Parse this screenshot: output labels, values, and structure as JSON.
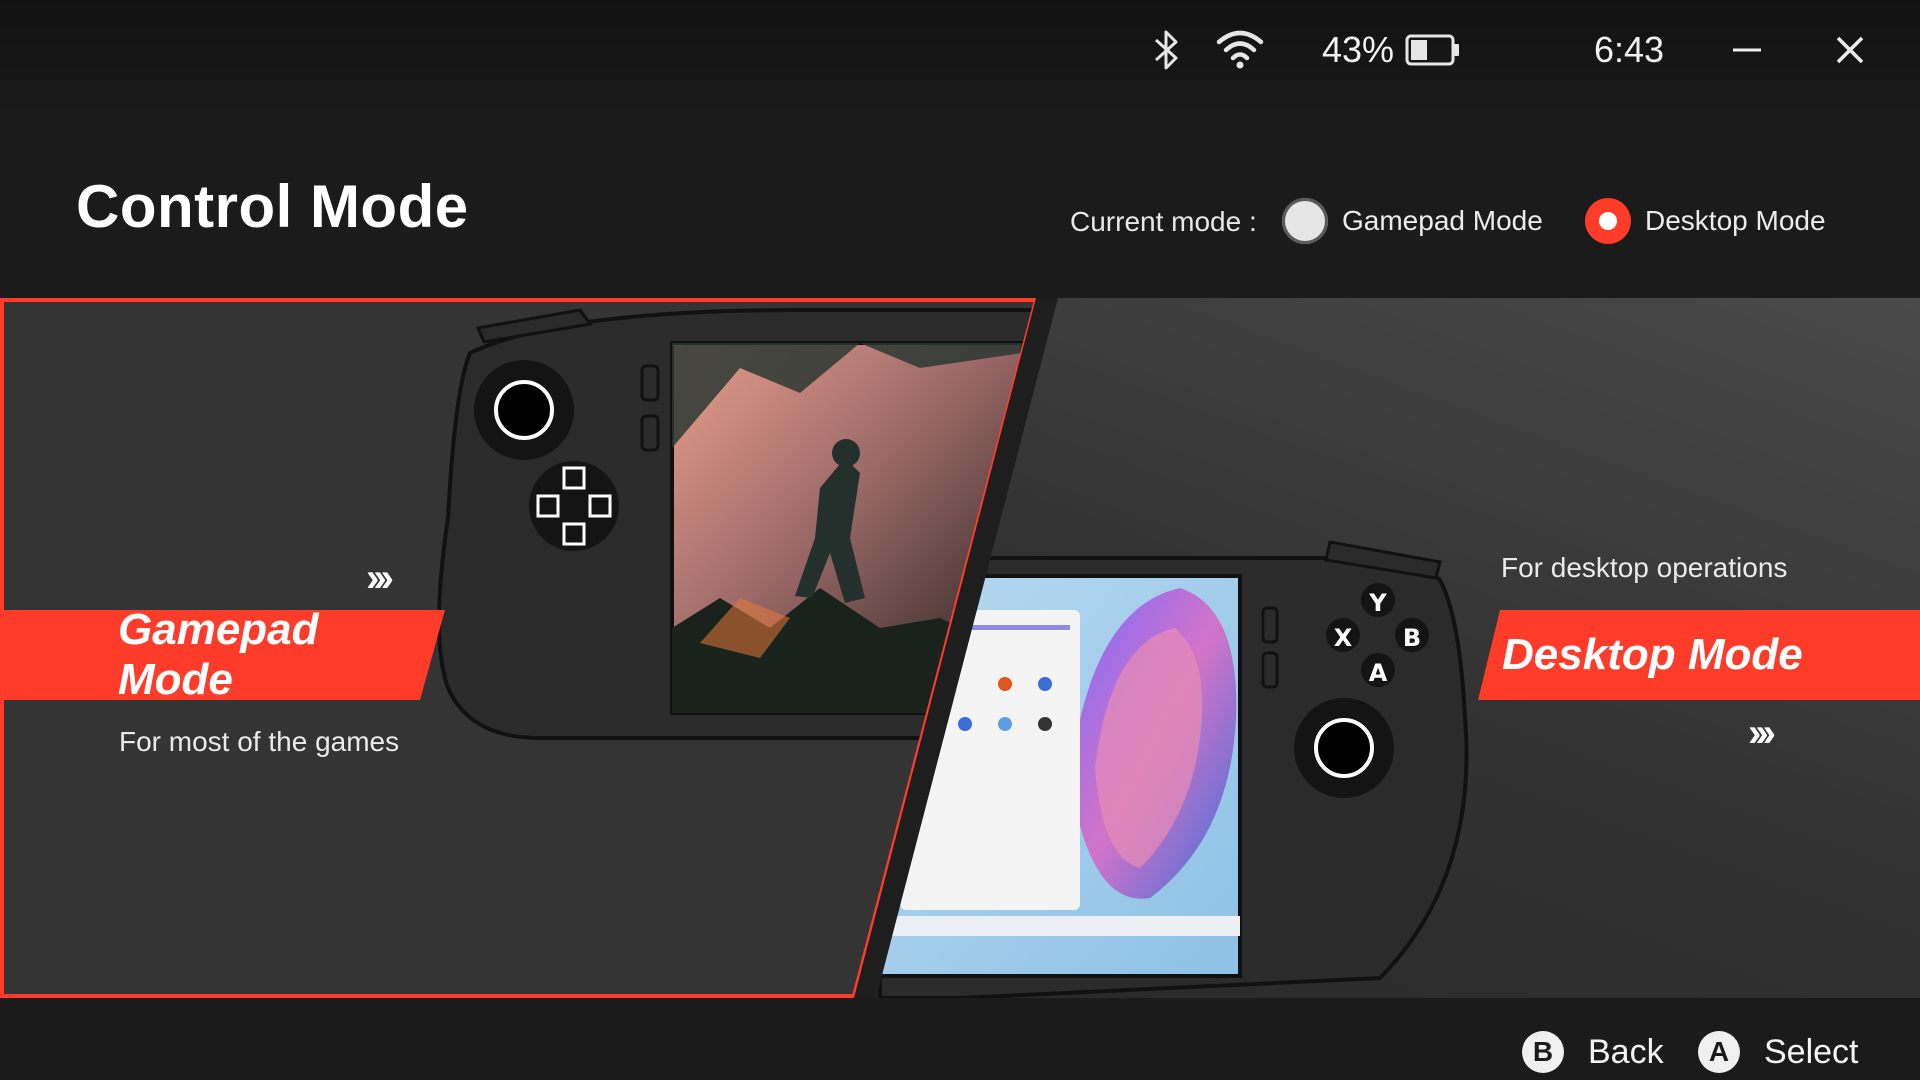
{
  "status_bar": {
    "battery_percent": "43%",
    "battery_level": 0.43,
    "time": "6:43",
    "icons": [
      "bluetooth-icon",
      "wifi-icon",
      "battery-icon",
      "minimize-icon",
      "close-icon"
    ]
  },
  "header": {
    "title": "Control Mode",
    "current_mode_label": "Current mode :",
    "options": [
      {
        "label": "Gamepad Mode",
        "selected": false
      },
      {
        "label": "Desktop Mode",
        "selected": true
      }
    ]
  },
  "modes": {
    "gamepad": {
      "title": "Gamepad Mode",
      "description": "For most of the games",
      "chevrons": "›››"
    },
    "desktop": {
      "title": "Desktop Mode",
      "description": "For desktop operations",
      "chevrons": "›››"
    }
  },
  "face_buttons": [
    "Y",
    "B",
    "A",
    "X"
  ],
  "hints": {
    "back": {
      "button": "B",
      "label": "Back"
    },
    "select": {
      "button": "A",
      "label": "Select"
    }
  },
  "colors": {
    "accent": "#ff3c2a",
    "background": "#1b1b1b",
    "panel": "#333333"
  }
}
